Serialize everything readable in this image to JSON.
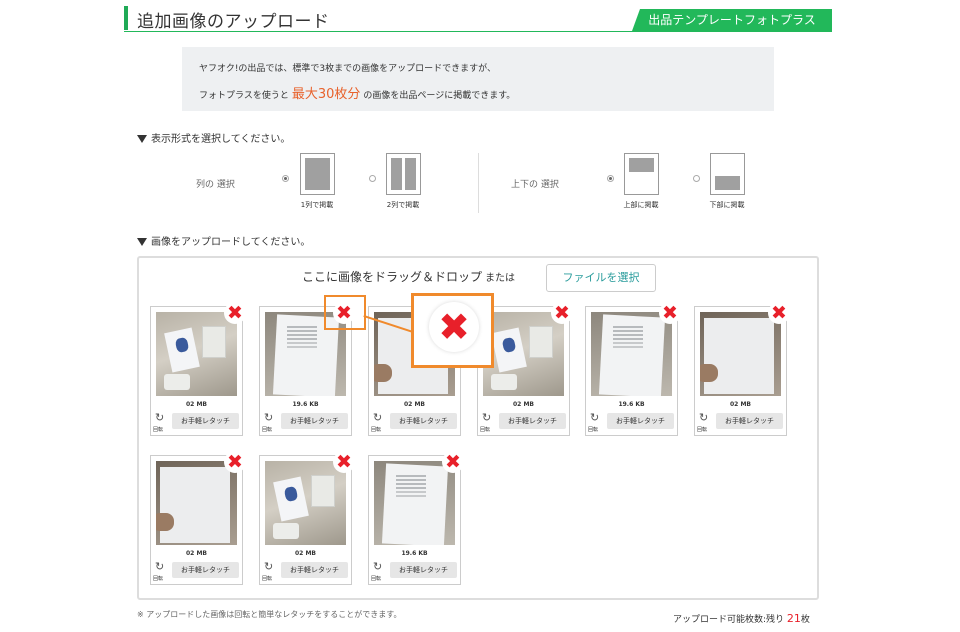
{
  "header": {
    "title": "追加画像のアップロード",
    "badge": "出品テンプレートフォトプラス"
  },
  "info": {
    "line1": "ヤフオク!の出品では、標準で3枚までの画像をアップロードできますが、",
    "line2_before": "フォトプラスを使うと",
    "line2_highlight": "最大30枚分",
    "line2_after": "の画像を出品ページに掲載できます。"
  },
  "display_section": {
    "heading": "表示形式を選択してください。",
    "columns": {
      "label": "列の 選択",
      "options": [
        {
          "caption": "1列で掲載",
          "selected": true
        },
        {
          "caption": "2列で掲載",
          "selected": false
        }
      ]
    },
    "vertical": {
      "label": "上下の 選択",
      "options": [
        {
          "caption": "上部に掲載",
          "selected": true
        },
        {
          "caption": "下部に掲載",
          "selected": false
        }
      ]
    }
  },
  "upload_section": {
    "heading": "画像をアップロードしてください。",
    "drop_text": "ここに画像をドラッグ＆ドロップ",
    "or_text": "または",
    "file_button": "ファイルを選択",
    "rotate_label": "回転",
    "touchup_label": "お手軽レタッチ",
    "delete_glyph": "✖",
    "images": [
      {
        "size": "02 MB",
        "kind": "product"
      },
      {
        "size": "19.6 KB",
        "kind": "paper"
      },
      {
        "size": "02 MB",
        "kind": "hand"
      },
      {
        "size": "02 MB",
        "kind": "product"
      },
      {
        "size": "19.6 KB",
        "kind": "paper"
      },
      {
        "size": "02 MB",
        "kind": "hand"
      },
      {
        "size": "02 MB",
        "kind": "hand"
      },
      {
        "size": "02 MB",
        "kind": "product"
      },
      {
        "size": "19.6 KB",
        "kind": "paper"
      }
    ]
  },
  "footer": {
    "note": "※ アップロードした画像は回転と簡単なレタッチをすることができます。",
    "remaining_label": "アップロード可能枚数:残り",
    "remaining_count": "21",
    "remaining_unit": "枚"
  },
  "colors": {
    "accent_green": "#22b85a",
    "highlight_orange": "#f08a2c",
    "delete_red": "#e8202a",
    "emphasis_orange": "#e8622c"
  }
}
